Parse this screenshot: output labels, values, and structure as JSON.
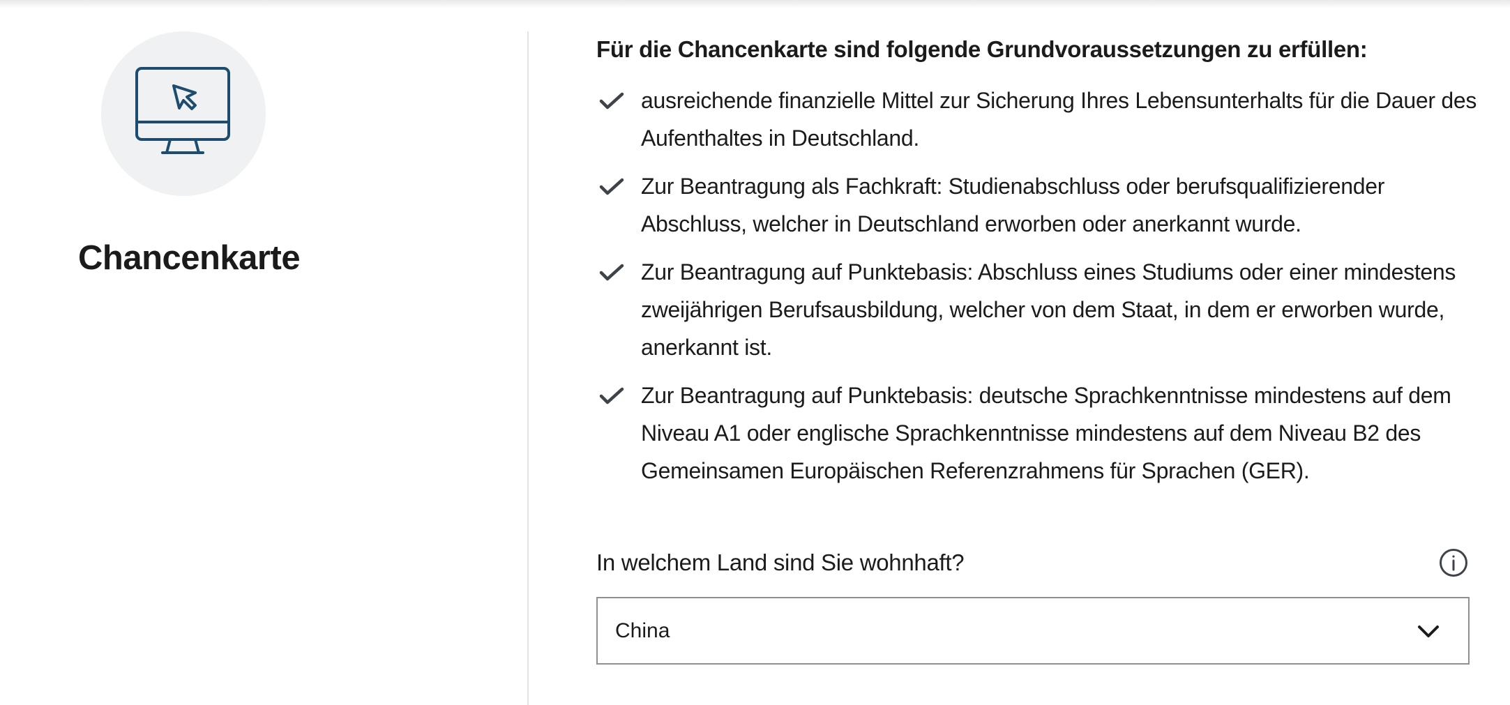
{
  "sidebar": {
    "icon": "computer-monitor-cursor-icon",
    "title": "Chancenkarte"
  },
  "requirements": {
    "heading": "Für die Chancenkarte sind folgende Grundvoraussetzungen zu erfüllen:",
    "items": [
      "ausreichende finanzielle Mittel zur Sicherung Ihres Lebensunterhalts für die Dauer des Aufenthaltes in Deutschland.",
      "Zur Beantragung als Fachkraft: Studienabschluss oder berufsqualifizierender Abschluss, welcher in Deutschland erworben oder anerkannt wurde.",
      "Zur Beantragung auf Punktebasis: Abschluss eines Studiums oder einer mindestens zweijährigen Berufsausbildung, welcher von dem Staat, in dem er erworben wurde, anerkannt ist.",
      "Zur Beantragung auf Punktebasis: deutsche Sprachkenntnisse mindestens auf dem Niveau A1 oder englische Sprachkenntnisse mindestens auf dem Niveau B2 des Gemeinsamen Europäischen Referenzrahmens für Sprachen (GER)."
    ]
  },
  "residence_question": {
    "label": "In welchem Land sind Sie wohnhaft?",
    "info_icon": "info-icon",
    "selected_value": "China",
    "dropdown_icon": "chevron-down-icon"
  },
  "colors": {
    "icon_stroke": "#1d4c6e",
    "icon_circle_bg": "#eff1f2",
    "check_color": "#3d4349",
    "divider": "#e3e4e6",
    "select_border": "#8c8f93"
  }
}
